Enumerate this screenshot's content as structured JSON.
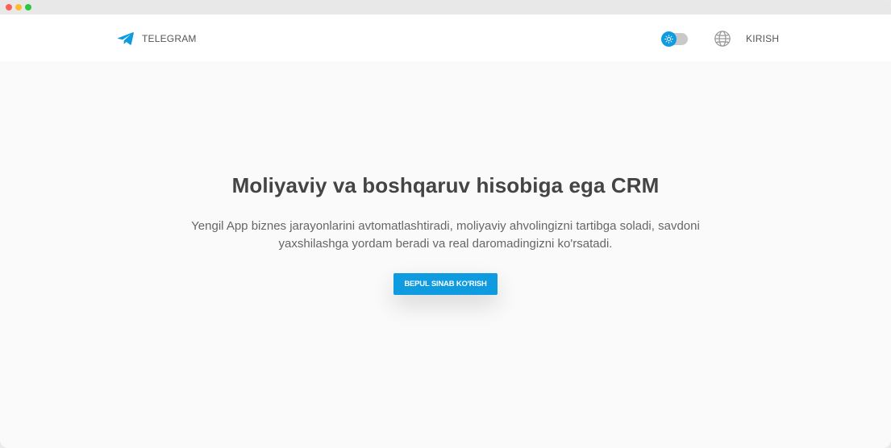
{
  "window": {
    "controls": [
      "close",
      "minimize",
      "maximize"
    ]
  },
  "navbar": {
    "brand_icon": "telegram-paper-plane-icon",
    "brand_label": "TELEGRAM",
    "theme_toggle_icon": "sun-icon",
    "language_icon": "globe-icon",
    "login_label": "KIRISH"
  },
  "hero": {
    "title": "Moliyaviy va boshqaruv hisobiga ega CRM",
    "subtitle": "Yengil App biznes jarayonlarini avtomatlashtiradi, moliyaviy ahvolingizni tartibga soladi, savdoni yaxshilashga yordam beradi va real daromadingizni ko'rsatadi.",
    "cta_label": "BEPUL SINAB KO'RISH"
  },
  "colors": {
    "accent": "#0e9be0",
    "text_dark": "#444444",
    "text_muted": "#666666",
    "page_background": "#fafafa"
  }
}
